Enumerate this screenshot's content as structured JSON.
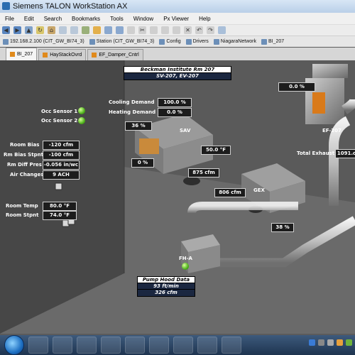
{
  "window": {
    "title": "Siemens TALON WorkStation AX"
  },
  "menu": [
    "File",
    "Edit",
    "Search",
    "Bookmarks",
    "Tools",
    "Window",
    "Px Viewer",
    "Help"
  ],
  "address": {
    "host": "192.168.2.100 (CIT_GW_BI74_3)",
    "station": "Station (CIT_GW_BI74_3)",
    "config": "Config",
    "drivers": "Drivers",
    "network": "NiagaraNetwork",
    "point": "BI_207"
  },
  "tabs": [
    "BI_207",
    "HayStackOvrd",
    "EF_Damper_Cntrl"
  ],
  "graphic": {
    "header_line1": "Beckman Institute Rm 207",
    "header_line2": "SV-207, EV-207",
    "occ_sensor_1": "Occ Sensor 1",
    "occ_sensor_2": "Occ Sensor 2",
    "cooling_demand_label": "Cooling Demand",
    "cooling_demand_value": "100.0 %",
    "heating_demand_label": "Heating Demand",
    "heating_demand_value": "0.0 %",
    "sav_damper_value": "36 %",
    "sav_label": "SAV",
    "sav_temp": "50.0 °F",
    "reheat_valve_value": "0 %",
    "sav_flow": "875 cfm",
    "gex_label": "GEX",
    "gex_flow": "806 cfm",
    "gex_damper": "38 %",
    "ef_label": "EF-207",
    "ef_damper": "0.0 %",
    "total_exhaust_label": "Total Exhaust",
    "total_exhaust_value": "1091.c",
    "room_bias_label": "Room Bias",
    "room_bias_value": "-120 cfm",
    "rm_bias_stpnt_label": "Rm Bias Stpnt",
    "rm_bias_stpnt_value": "-100 cfm",
    "rm_diff_pres_label": "Rm Diff Pres",
    "rm_diff_pres_value": "-0.056 in/wc",
    "air_changes_label": "Air Changes",
    "air_changes_value": "9 ACH",
    "room_temp_label": "Room Temp",
    "room_temp_value": "80.0 °F",
    "room_stpnt_label": "Room Stpnt",
    "room_stpnt_value": "74.0 °F",
    "fh_label": "FH-A",
    "pump_head_label": "Pump Hood Data",
    "pump_face_velocity": "93 ft/min",
    "pump_flow": "326 cfm"
  },
  "colors": {
    "led_on": "#4fb21c",
    "canvas": "#555555",
    "taskbar": "#1e3450"
  }
}
